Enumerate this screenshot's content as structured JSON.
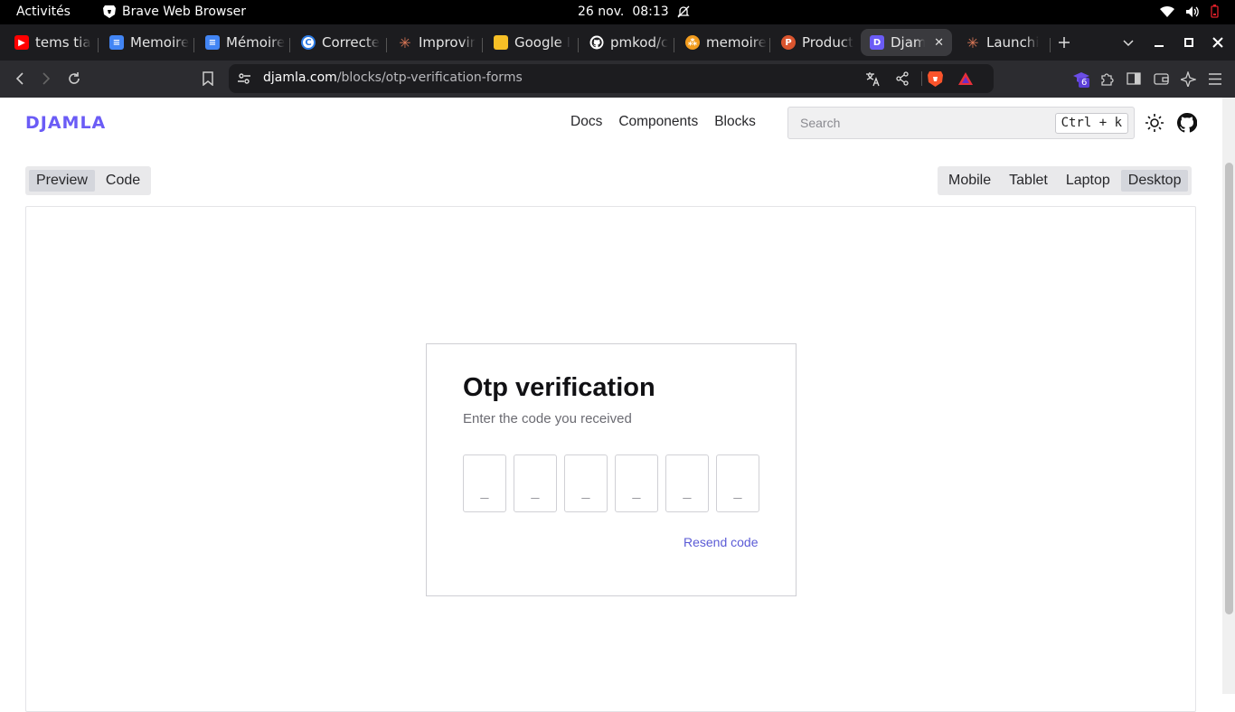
{
  "topbar": {
    "activities": "Activités",
    "app_name": "Brave Web Browser",
    "date": "26 nov.",
    "time": "08:13"
  },
  "tabs": [
    {
      "title": "tems tia",
      "favicon": "youtube-icon",
      "color": "#ff0000",
      "glyph": "▶"
    },
    {
      "title": "Memoire",
      "favicon": "google-docs-icon",
      "color": "#4285f4",
      "glyph": "≡"
    },
    {
      "title": "Mémoire",
      "favicon": "google-docs-icon",
      "color": "#4285f4",
      "glyph": "≡"
    },
    {
      "title": "Correcte",
      "favicon": "corrector-icon",
      "color": "#2c7be5",
      "glyph": "C"
    },
    {
      "title": "Improvir",
      "favicon": "claude-icon",
      "color": "#d97757",
      "glyph": "✳"
    },
    {
      "title": "Google I",
      "favicon": "google-keep-icon",
      "color": "#f6bf26",
      "glyph": "●"
    },
    {
      "title": "pmkod/c",
      "favicon": "github-icon",
      "color": "#2b2b2b",
      "glyph": "●"
    },
    {
      "title": "memoire",
      "favicon": "overleaf-icon",
      "color": "#f29c1e",
      "glyph": "⁂"
    },
    {
      "title": "Product",
      "favicon": "producthunt-icon",
      "color": "#da552f",
      "glyph": "P"
    },
    {
      "title": "Djam",
      "favicon": "djamla-icon",
      "color": "#6b5cf6",
      "glyph": "D",
      "active": true
    },
    {
      "title": "Launchi",
      "favicon": "claude-icon",
      "color": "#d97757",
      "glyph": "✳"
    }
  ],
  "address": {
    "host": "djamla.com",
    "path": "/blocks/otp-verification-forms"
  },
  "extensions_badge": "6",
  "site": {
    "logo": "DJAMLA",
    "nav": [
      "Docs",
      "Components",
      "Blocks"
    ],
    "search_placeholder": "Search",
    "search_shortcut": "Ctrl + k"
  },
  "view_toggle": {
    "options": [
      "Preview",
      "Code"
    ],
    "selected": "Preview"
  },
  "device_toggle": {
    "options": [
      "Mobile",
      "Tablet",
      "Laptop",
      "Desktop"
    ],
    "selected": "Desktop"
  },
  "otp_form": {
    "title": "Otp verification",
    "subtitle": "Enter the code you received",
    "digits": [
      "_",
      "_",
      "_",
      "_",
      "_",
      "_"
    ],
    "resend_label": "Resend code",
    "link_color": "#5b5bd6"
  }
}
